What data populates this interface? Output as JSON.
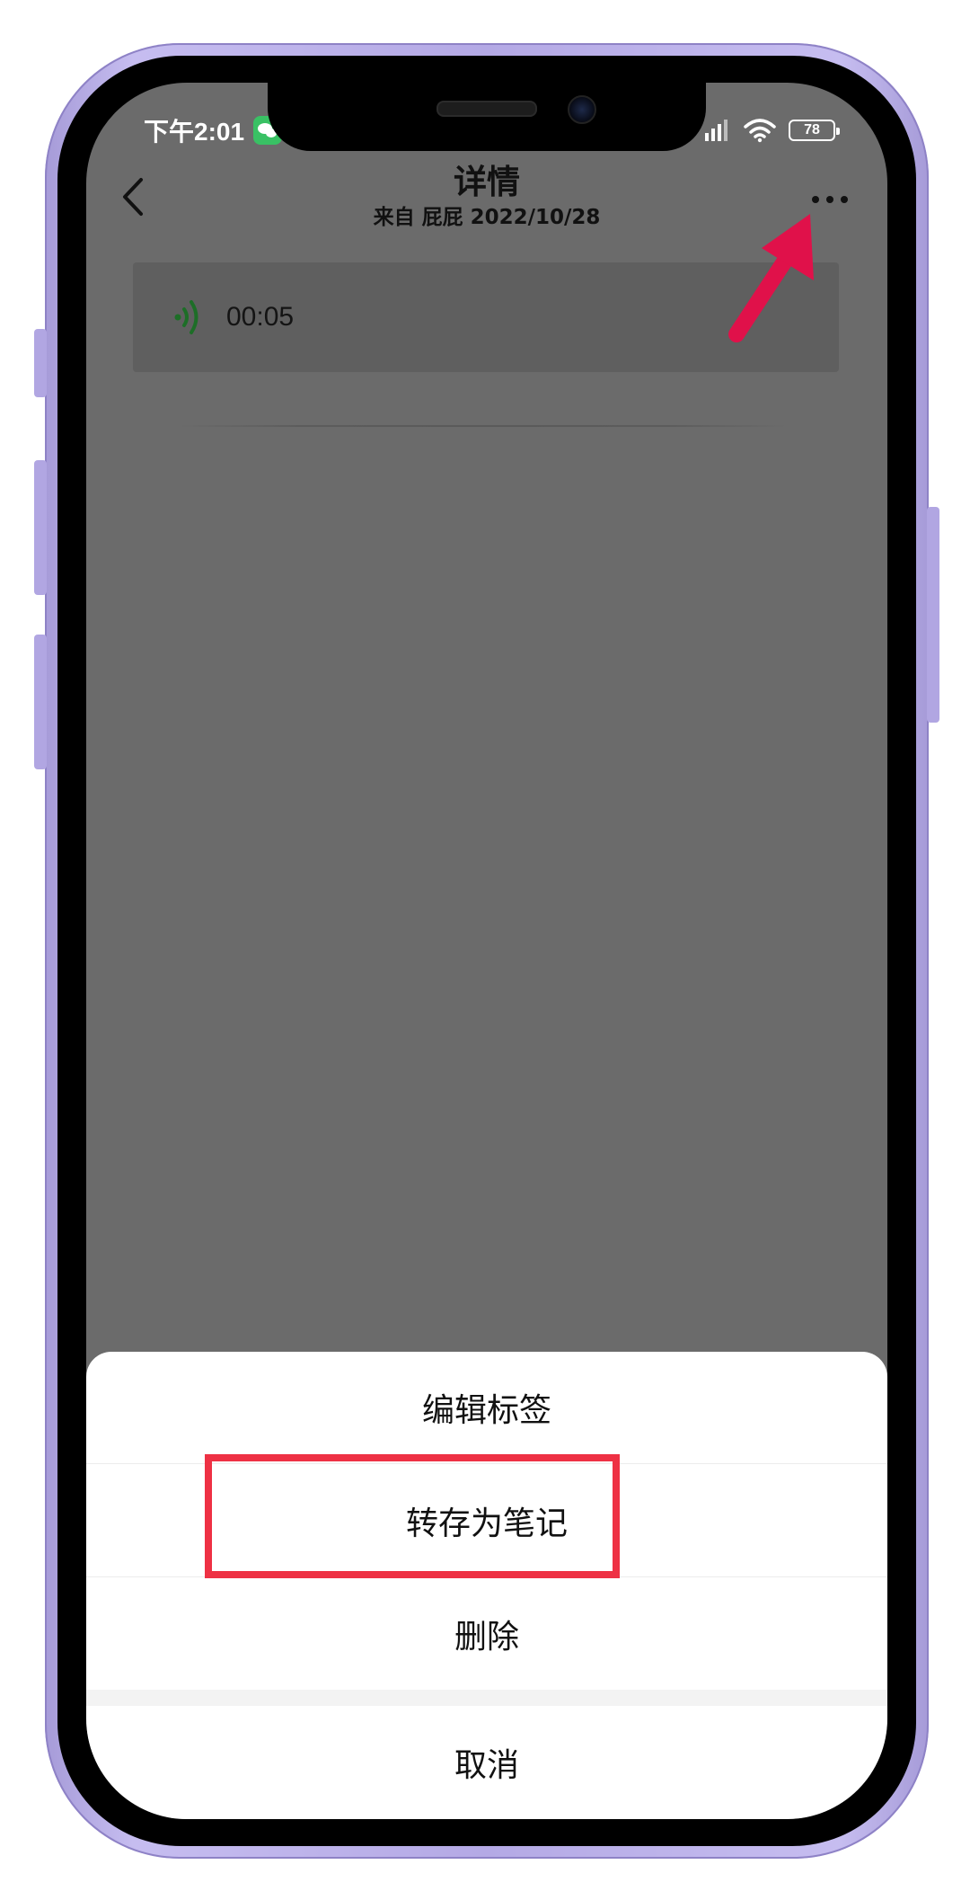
{
  "status_bar": {
    "time": "下午2:01",
    "battery": "78"
  },
  "header": {
    "title": "详情",
    "subtitle": "来自 屁屁 2022/10/28"
  },
  "voice": {
    "duration": "00:05"
  },
  "sheet": {
    "items": [
      {
        "label": "编辑标签"
      },
      {
        "label": "转存为笔记"
      },
      {
        "label": "删除"
      }
    ],
    "cancel": "取消"
  },
  "colors": {
    "overlay": "#6b6b6b",
    "frame": "#b4a9e5",
    "voice_icon": "#1d8f2f",
    "arrow": "#e0114a",
    "highlight": "#ee3144"
  },
  "icons": {
    "back": "chevron-left-icon",
    "more": "more-dots-icon",
    "voice": "voice-wave-icon",
    "signal": "signal-icon",
    "wifi": "wifi-icon",
    "wechat": "wechat-icon"
  }
}
